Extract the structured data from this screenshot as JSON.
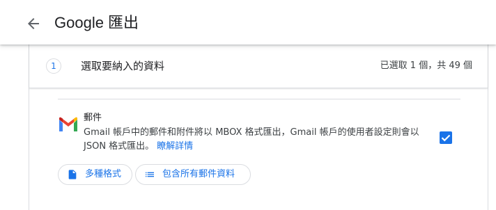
{
  "header": {
    "back_icon": "arrow-back-icon",
    "title": "Google 匯出"
  },
  "step": {
    "number": "1",
    "title": "選取要納入的資料",
    "selection_count": "已選取 1 個，共 49 個"
  },
  "product": {
    "icon": "gmail-logo-icon",
    "name": "郵件",
    "description": "Gmail 帳戶中的郵件和附件將以 MBOX 格式匯出，Gmail 帳戶的使用者設定則會以 JSON 格式匯出。",
    "learn_more": "瞭解詳情",
    "selected": true,
    "chips": [
      {
        "icon": "file-icon",
        "label": "多種格式"
      },
      {
        "icon": "list-icon",
        "label": "包含所有郵件資料"
      }
    ]
  },
  "colors": {
    "accent": "#1a73e8",
    "text_primary": "#202124",
    "text_secondary": "#3c4043",
    "border": "#dadce0"
  }
}
